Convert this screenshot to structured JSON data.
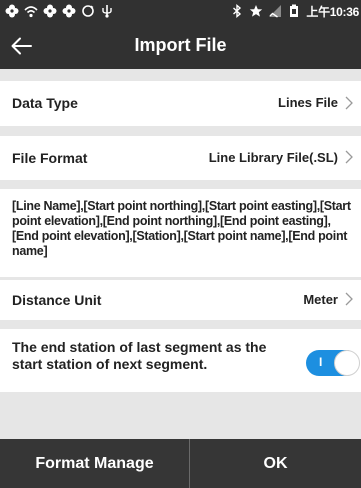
{
  "status_bar": {
    "time": "上午10:36",
    "left_icons": [
      "clover-icon",
      "wifi-icon",
      "clover-icon",
      "clover-icon",
      "sync-icon",
      "usb-icon"
    ],
    "right_icons": [
      "bluetooth-icon",
      "star-icon",
      "signal-icon",
      "battery-icon"
    ]
  },
  "header": {
    "title": "Import File",
    "back_icon": "back-arrow-icon"
  },
  "settings": {
    "data_type": {
      "label": "Data Type",
      "value": "Lines File"
    },
    "file_format": {
      "label": "File Format",
      "value": "Line Library File(.SL)"
    },
    "format_description": "[Line Name],[Start point northing],[Start point easting],[Start point elevation],[End point northing],[End point easting],[End point elevation],[Station],[Start point name],[End point name]",
    "distance_unit": {
      "label": "Distance Unit",
      "value": "Meter"
    },
    "continuous_station": {
      "label": "The end station of last segment as the start station of next segment.",
      "enabled": true,
      "on_text": "I"
    }
  },
  "footer": {
    "format_manage_label": "Format Manage",
    "ok_label": "OK"
  },
  "colors": {
    "app_bar": "#313131",
    "background": "#e6e6e6",
    "toggle_on": "#1d8fe0",
    "footer_button": "#363636"
  }
}
